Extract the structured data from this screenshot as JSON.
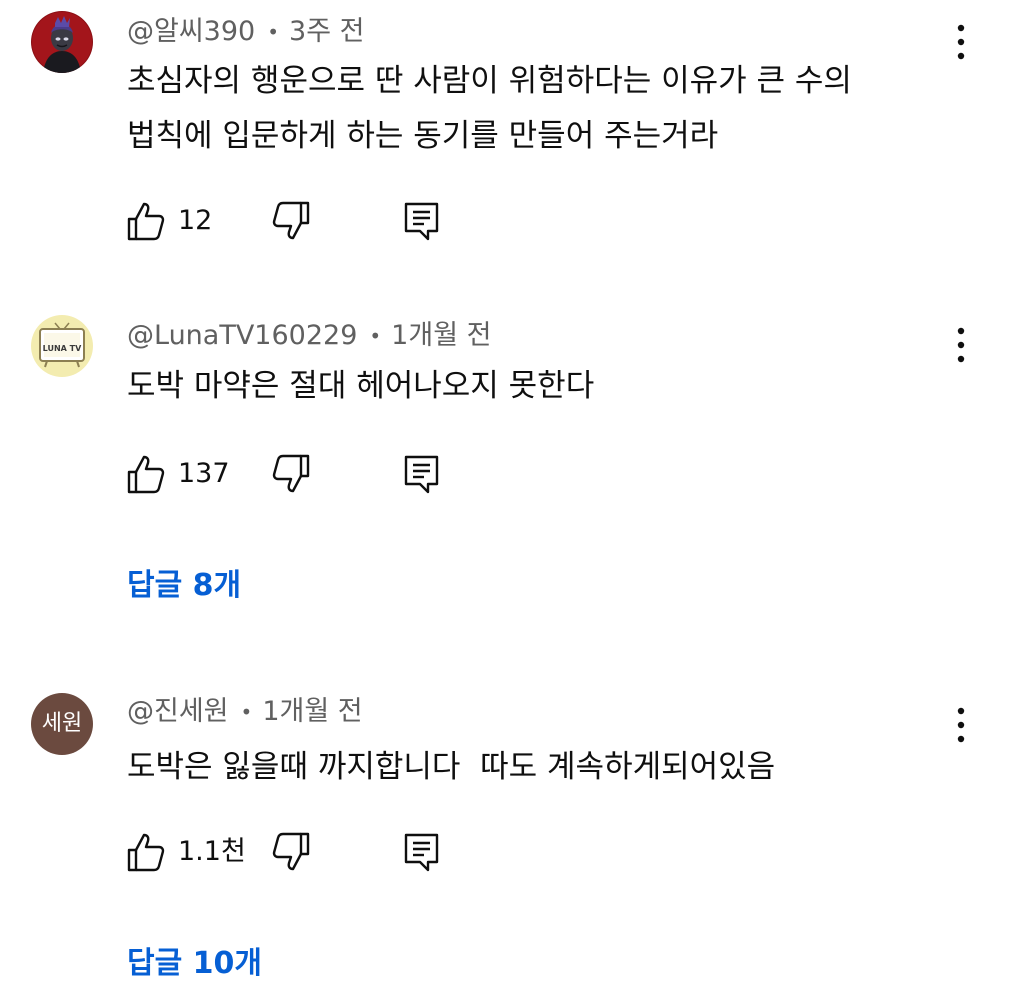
{
  "comments": [
    {
      "author": "@알씨390",
      "age": "3주 전",
      "text": "초심자의 행운으로 딴 사람이 위험하다는 이유가 큰 수의\n법칙에 입문하게 하는 동기를 만들어 주는거라",
      "likes": "12",
      "avatar_icon": "hooded-figure-avatar",
      "avatar_bg": "#8b0f14"
    },
    {
      "author": "@LunaTV160229",
      "age": "1개월 전",
      "text": "도박 마약은 절대 헤어나오지 못한다",
      "likes": "137",
      "avatar_label": "LUNA TV",
      "avatar_bg": "#f3ecb0",
      "replies_label": "답글 8개"
    },
    {
      "author": "@진세원",
      "age": "1개월 전",
      "text": "도박은 잃을때 까지합니다  따도 계속하게되어있음",
      "likes": "1.1천",
      "avatar_label": "세원",
      "avatar_bg": "#6b4a3f",
      "replies_label": "답글 10개"
    }
  ],
  "colors": {
    "text": "#0f0f0f",
    "secondary": "#606060",
    "link": "#065fd4"
  },
  "icons": [
    "thumbs-up-icon",
    "thumbs-down-icon",
    "reply-icon",
    "more-vert-icon"
  ]
}
